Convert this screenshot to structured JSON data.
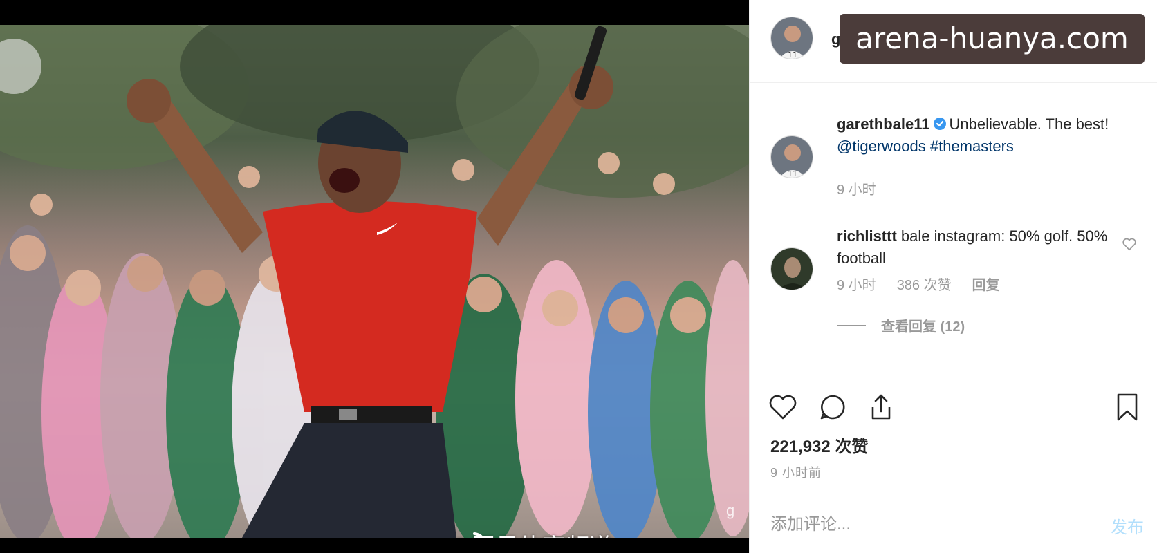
{
  "photo": {
    "watermark": "@网易体育频道",
    "corner_mark": "g"
  },
  "overlay": {
    "url_text": "arena-huanya.com"
  },
  "post": {
    "author": "garethbale11",
    "comments": [
      {
        "username": "garethbale11",
        "verified": true,
        "text_before": "Unbelievable. The best! ",
        "mention": "@tigerwoods",
        "hashtag": "#themasters",
        "time": "9 小时"
      },
      {
        "username": "richlisttt",
        "text": "bale instagram: 50% golf. 50% football",
        "time": "9 小时",
        "likes": "386 次赞",
        "reply_label": "回复",
        "view_replies": "查看回复 (12)"
      }
    ],
    "likes": "221,932 次赞",
    "timestamp": "9 小时前",
    "add_comment_placeholder": "添加评论...",
    "post_button": "发布"
  },
  "icons": {
    "like": "heart-icon",
    "comment": "comment-bubble-icon",
    "share": "share-icon",
    "save": "bookmark-icon"
  },
  "colors": {
    "shirt": "#d42a20",
    "verified": "#3897f0",
    "mention": "#003569",
    "overlay_bg": "#4b3c3a"
  }
}
